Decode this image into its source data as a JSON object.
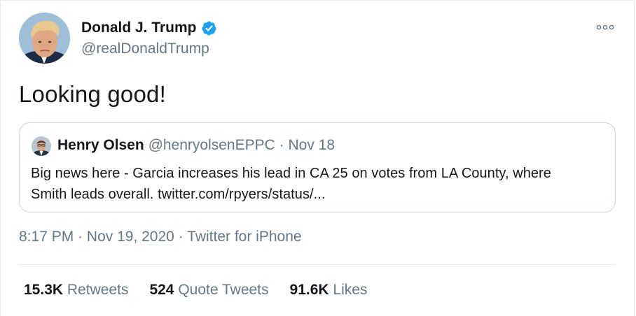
{
  "tweet": {
    "author": {
      "name": "Donald J. Trump",
      "handle": "@realDonaldTrump",
      "verified": true
    },
    "text": "Looking good!",
    "quoted": {
      "name": "Henry Olsen",
      "handle": "@henryolsenEPPC",
      "separator": "·",
      "date": "Nov 18",
      "text_line1": "Big news here - Garcia increases his lead in CA 25 on votes from LA County, where",
      "text_line2": "Smith leads overall. twitter.com/rpyers/status/..."
    },
    "meta": {
      "time": "8:17 PM",
      "separator": "·",
      "date": "Nov 19, 2020",
      "source": "Twitter for iPhone"
    },
    "stats": {
      "retweets_count": "15.3K",
      "retweets_label": "Retweets",
      "quotes_count": "524",
      "quotes_label": "Quote Tweets",
      "likes_count": "91.6K",
      "likes_label": "Likes"
    }
  },
  "colors": {
    "verified": "#1da1f2",
    "secondary_text": "#657786",
    "primary_text": "#14171a",
    "border": "#ccd6dd"
  },
  "icons": {
    "verified": "verified-badge-icon",
    "more": "more-options-icon"
  }
}
